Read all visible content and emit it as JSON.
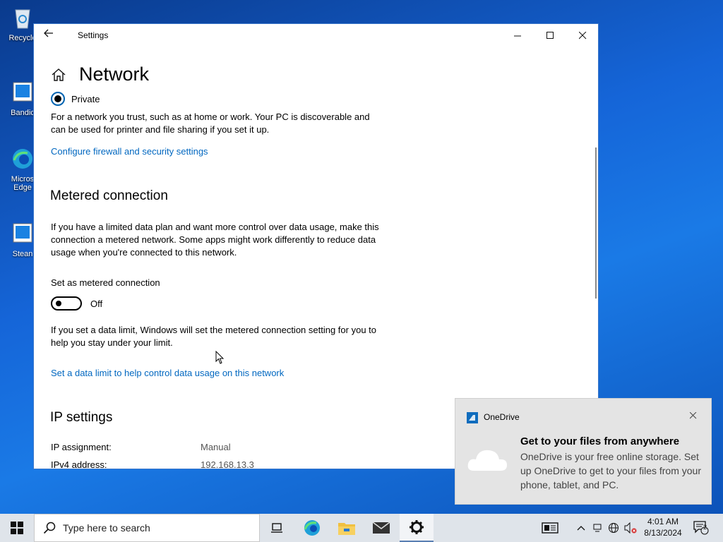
{
  "desktop": {
    "icons": [
      {
        "label": "Recycle"
      },
      {
        "label": "Bandic"
      },
      {
        "label": "Micros\nEdge"
      },
      {
        "label": "Stean"
      }
    ]
  },
  "window": {
    "title": "Settings",
    "page_title": "Network",
    "radio_private_label": "Private",
    "private_desc": "For a network you trust, such as at home or work. Your PC is discoverable and can be used for printer and file sharing if you set it up.",
    "firewall_link": "Configure firewall and security settings",
    "metered_heading": "Metered connection",
    "metered_desc": "If you have a limited data plan and want more control over data usage, make this connection a metered network. Some apps might work differently to reduce data usage when you're connected to this network.",
    "metered_toggle_label": "Set as metered connection",
    "metered_toggle_state": "Off",
    "data_limit_desc": "If you set a data limit, Windows will set the metered connection setting for you to help you stay under your limit.",
    "data_limit_link": "Set a data limit to help control data usage on this network",
    "ip_heading": "IP settings",
    "ip_rows": [
      {
        "key": "IP assignment:",
        "value": "Manual"
      },
      {
        "key": "IPv4 address:",
        "value": "192.168.13.3"
      }
    ]
  },
  "toast": {
    "app_name": "OneDrive",
    "title": "Get to your files from anywhere",
    "body": "OneDrive is your free online storage. Set up OneDrive to get to your files from your phone, tablet, and PC."
  },
  "taskbar": {
    "search_placeholder": "Type here to search",
    "time": "4:01 AM",
    "date": "8/13/2024",
    "notification_count": "2"
  },
  "colors": {
    "accent": "#0067c0",
    "taskbar_bg": "#dfe4ea",
    "toast_bg": "#e4e4e4"
  }
}
